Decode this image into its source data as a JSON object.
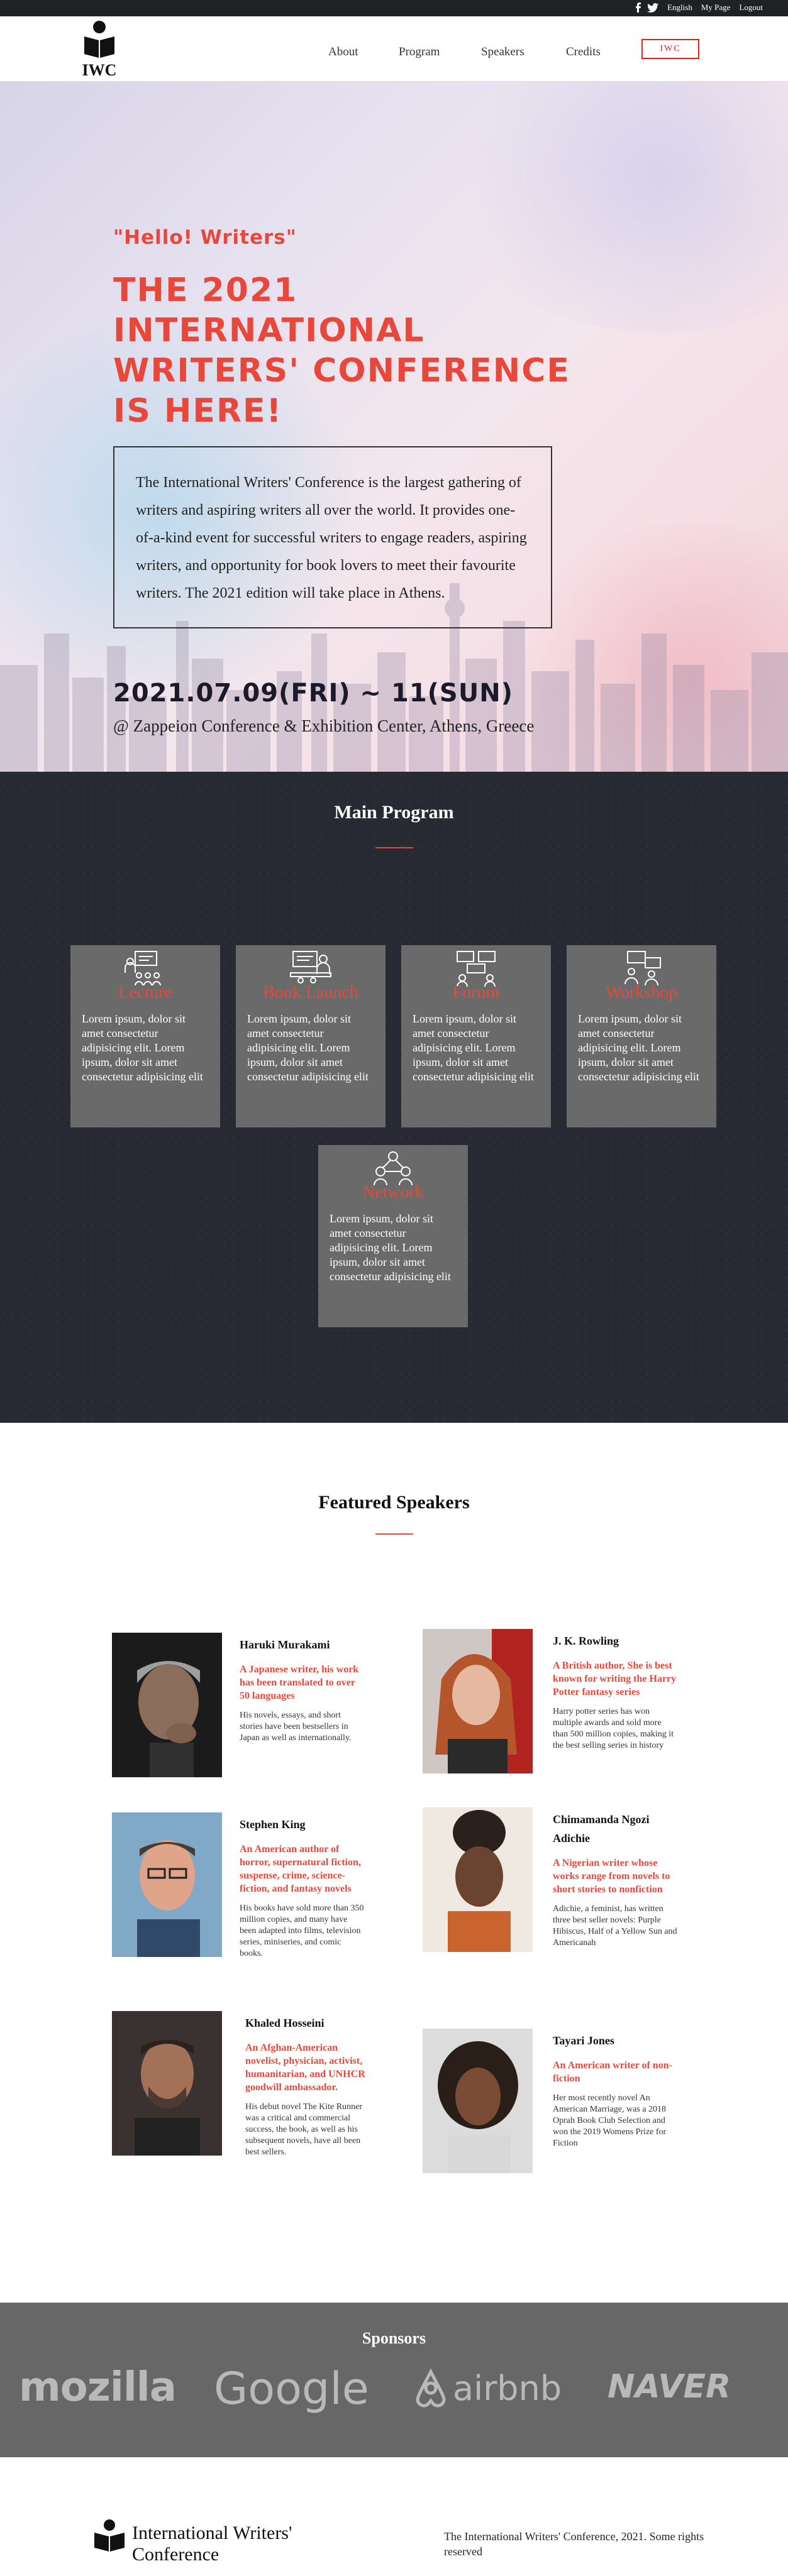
{
  "topbar": {
    "social": [
      "facebook-icon",
      "twitter-icon"
    ],
    "language": "English",
    "my_page": "My Page",
    "logout": "Logout"
  },
  "header": {
    "logo_text": "IWC",
    "nav": {
      "about": "About",
      "program": "Program",
      "speakers": "Speakers",
      "credits": "Credits",
      "iwc": "IWC"
    }
  },
  "hero": {
    "hello": "\"Hello! Writers\"",
    "title": "THE 2021 INTERNATIONAL WRITERS' CONFERENCE IS HERE!",
    "description": "The International Writers' Conference is the largest gathering of writers and aspiring writers all over the world. It provides one-of-a-kind event for successful writers to engage readers, aspiring writers, and opportunity for book lovers to meet their favourite writers. The 2021 edition will take place in Athens.",
    "date": "2021.07.09(FRI) ~ 11(SUN)",
    "venue": "@ Zappeion Conference & Exhibition Center, Athens, Greece"
  },
  "program": {
    "title": "Main Program",
    "items": [
      {
        "title": "Lecture",
        "icon": "lecture-icon",
        "text": "Lorem ipsum, dolor sit amet consectetur adipisicing elit. Lorem ipsum, dolor sit amet consectetur adipisicing elit"
      },
      {
        "title": "Book Launch",
        "icon": "book-launch-icon",
        "text": "Lorem ipsum, dolor sit amet consectetur adipisicing elit. Lorem ipsum, dolor sit amet consectetur adipisicing elit"
      },
      {
        "title": "Forum",
        "icon": "forum-icon",
        "text": "Lorem ipsum, dolor sit amet consectetur adipisicing elit. Lorem ipsum, dolor sit amet consectetur adipisicing elit"
      },
      {
        "title": "Workshop",
        "icon": "workshop-icon",
        "text": "Lorem ipsum, dolor sit amet consectetur adipisicing elit. Lorem ipsum, dolor sit amet consectetur adipisicing elit"
      },
      {
        "title": "Network",
        "icon": "network-icon",
        "text": "Lorem ipsum, dolor sit amet consectetur adipisicing elit. Lorem ipsum, dolor sit amet consectetur adipisicing elit"
      }
    ]
  },
  "speakers": {
    "title": "Featured Speakers",
    "items": [
      {
        "name": "Haruki Murakami",
        "role": "A Japanese writer, his work has been translated to over 50 languages",
        "desc": "His novels, essays, and short stories have been bestsellers in Japan as well as internationally."
      },
      {
        "name": "J. K. Rowling",
        "role": "A British author, She is best known for writing the Harry Potter fantasy series",
        "desc": "Harry potter series has won multiple awards and sold more than 500 million copies, making it the best selling series in history"
      },
      {
        "name": "Stephen King",
        "role": "An American author of horror, supernatural fiction, suspense, crime, science-fiction, and fantasy novels",
        "desc": "His books have sold more than 350 million copies, and many have been adapted into films, television series, miniseries, and comic books."
      },
      {
        "name": "Chimamanda Ngozi Adichie",
        "role": "A Nigerian writer whose works range from novels to short stories to nonfiction",
        "desc": "Adichie, a feminist, has written three best seller novels: Purple Hibiscus, Half of a Yellow Sun and Americanah"
      },
      {
        "name": "Khaled Hosseini",
        "role": "An Afghan-American novelist, physician, activist, humanitarian, and UNHCR goodwill ambassador.",
        "desc": "His debut novel The Kite Runner was a critical and commercial success, the book, as well as his subsequent novels, have all been best sellers."
      },
      {
        "name": "Tayari Jones",
        "role": "An American writer of non-fiction",
        "desc": "Her most recently novel An American Marriage, was a 2018 Oprah Book Club Selection and won the 2019 Womens Prize for Fiction"
      }
    ]
  },
  "sponsors": {
    "title": "Sponsors",
    "logos": [
      "mozilla",
      "Google",
      "airbnb",
      "NAVER"
    ]
  },
  "footer": {
    "name": "International Writers' Conference",
    "copyright": "The International Writers' Conference, 2021. Some rights reserved"
  },
  "colors": {
    "accent": "#e8473a",
    "dark": "#282a33",
    "card": "#6b6a6b",
    "sponsor_bg": "#676767"
  }
}
